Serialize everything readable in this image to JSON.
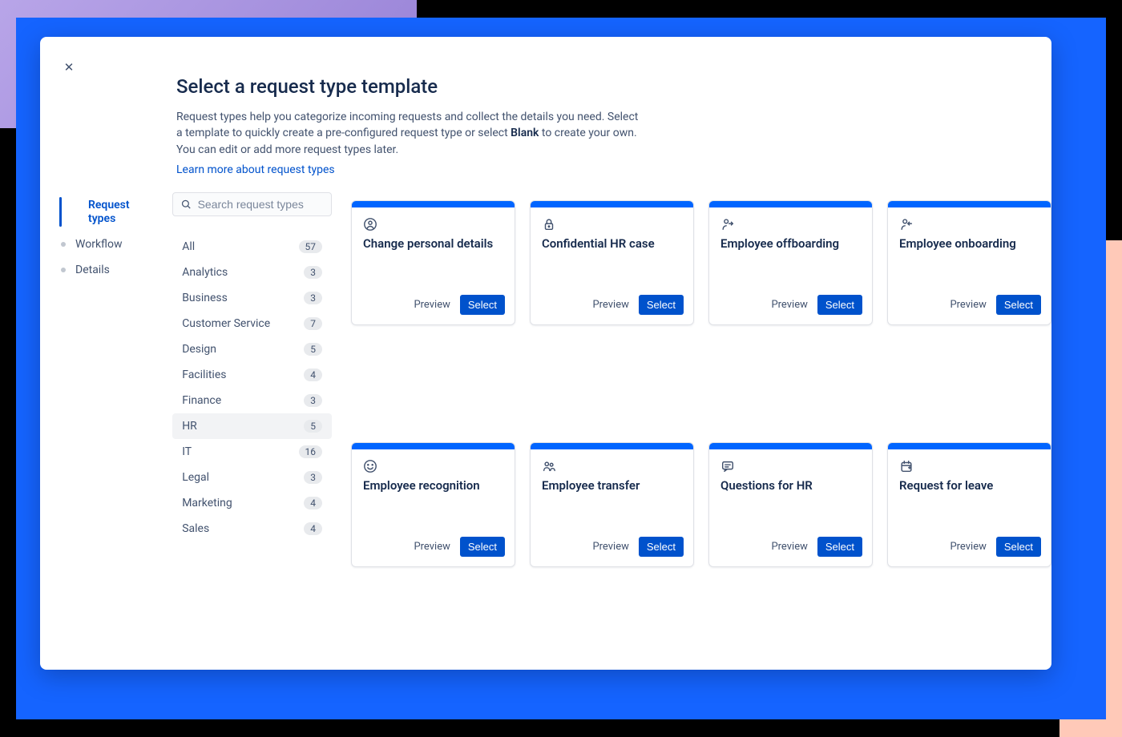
{
  "header": {
    "title": "Select a request type template",
    "subtitle_pre": "Request types help you categorize incoming requests and collect the details you need. Select a template to quickly create a pre-configured request type or select ",
    "subtitle_bold": "Blank",
    "subtitle_post": " to create your own. You can edit or add more request types later.",
    "learn_more": "Learn more about request types"
  },
  "nav": {
    "items": [
      {
        "label": "Request types",
        "active": true
      },
      {
        "label": "Workflow",
        "active": false
      },
      {
        "label": "Details",
        "active": false
      }
    ]
  },
  "search": {
    "placeholder": "Search request types"
  },
  "categories": [
    {
      "label": "All",
      "count": "57",
      "selected": false
    },
    {
      "label": "Analytics",
      "count": "3",
      "selected": false
    },
    {
      "label": "Business",
      "count": "3",
      "selected": false
    },
    {
      "label": "Customer Service",
      "count": "7",
      "selected": false
    },
    {
      "label": "Design",
      "count": "5",
      "selected": false
    },
    {
      "label": "Facilities",
      "count": "4",
      "selected": false
    },
    {
      "label": "Finance",
      "count": "3",
      "selected": false
    },
    {
      "label": "HR",
      "count": "5",
      "selected": true
    },
    {
      "label": "IT",
      "count": "16",
      "selected": false
    },
    {
      "label": "Legal",
      "count": "3",
      "selected": false
    },
    {
      "label": "Marketing",
      "count": "4",
      "selected": false
    },
    {
      "label": "Sales",
      "count": "4",
      "selected": false
    }
  ],
  "card_labels": {
    "preview": "Preview",
    "select": "Select"
  },
  "cards": [
    {
      "title": "Change personal details",
      "icon": "person-circle"
    },
    {
      "title": "Confidential HR case",
      "icon": "lock"
    },
    {
      "title": "Employee offboarding",
      "icon": "person-out"
    },
    {
      "title": "Employee onboarding",
      "icon": "person-in"
    },
    {
      "title": "Employee recognition",
      "icon": "smile"
    },
    {
      "title": "Employee transfer",
      "icon": "people"
    },
    {
      "title": "Questions for HR",
      "icon": "chat"
    },
    {
      "title": "Request for leave",
      "icon": "calendar"
    }
  ]
}
